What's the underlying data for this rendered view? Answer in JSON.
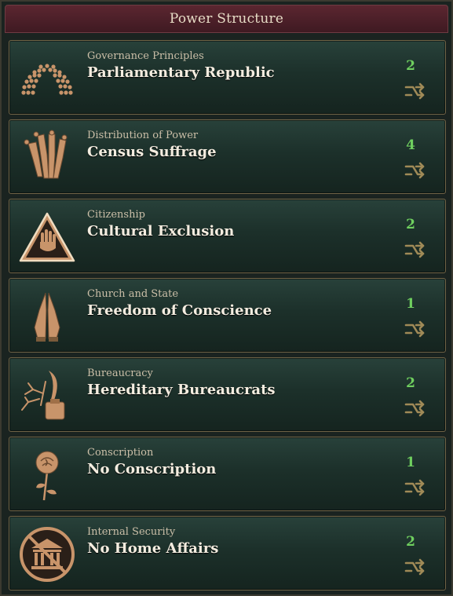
{
  "header": {
    "title": "Power Structure"
  },
  "laws": [
    {
      "category": "Governance Principles",
      "name": "Parliamentary Republic",
      "count": "2",
      "icon": "parliament-icon"
    },
    {
      "category": "Distribution of Power",
      "name": "Census Suffrage",
      "count": "4",
      "icon": "raised-hands-icon"
    },
    {
      "category": "Citizenship",
      "name": "Cultural Exclusion",
      "count": "2",
      "icon": "stop-hand-warning-icon"
    },
    {
      "category": "Church and State",
      "name": "Freedom of Conscience",
      "count": "1",
      "icon": "praying-hands-icon"
    },
    {
      "category": "Bureaucracy",
      "name": "Hereditary Bureaucrats",
      "count": "2",
      "icon": "quill-inkwell-icon"
    },
    {
      "category": "Conscription",
      "name": "No Conscription",
      "count": "1",
      "icon": "rose-icon"
    },
    {
      "category": "Internal Security",
      "name": "No Home Affairs",
      "count": "2",
      "icon": "no-building-icon"
    }
  ],
  "colors": {
    "count_green": "#6fcf5f",
    "header_bg": "#5b2630",
    "card_border": "#6f6346",
    "icon_bronze": "#c8946a"
  }
}
